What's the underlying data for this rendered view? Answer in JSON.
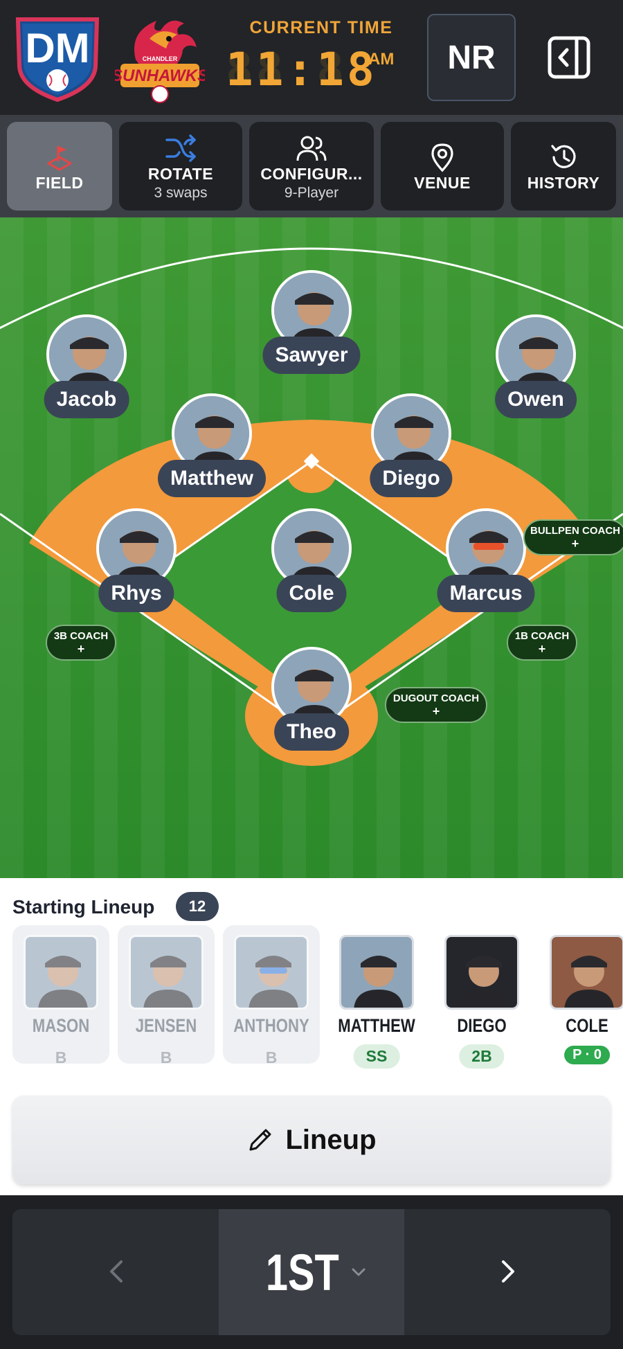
{
  "header": {
    "logo_dm_text": "DM",
    "logo_team_text": "SUNHAWKS",
    "logo_team_small": "CHANDLER",
    "time_label": "CURRENT TIME",
    "time_digits": "11:18",
    "time_ampm": "AM",
    "nr_label": "NR",
    "panel_icon": "sidebar-collapse-icon",
    "accent": "#f2a635"
  },
  "tabs": [
    {
      "label": "FIELD",
      "sub": "",
      "icon": "field-flag-icon",
      "active": true
    },
    {
      "label": "ROTATE",
      "sub": "3 swaps",
      "icon": "shuffle-icon",
      "active": false
    },
    {
      "label": "CONFIGUR...",
      "sub": "9-Player",
      "icon": "users-icon",
      "active": false
    },
    {
      "label": "VENUE",
      "sub": "",
      "icon": "map-pin-icon",
      "active": false
    },
    {
      "label": "HISTORY",
      "sub": "",
      "icon": "history-icon",
      "active": false
    }
  ],
  "field": {
    "players": {
      "cf": "Sawyer",
      "lf": "Jacob",
      "rf": "Owen",
      "ss": "Matthew",
      "second": "Diego",
      "third": "Rhys",
      "pitcher": "Cole",
      "first": "Marcus",
      "catcher": "Theo"
    },
    "coaches": {
      "bullpen": "BULLPEN COACH",
      "third_base": "3B COACH",
      "first_base": "1B COACH",
      "dugout": "DUGOUT COACH",
      "plus": "+"
    },
    "grass_color": "#3a9a36",
    "dirt_color": "#f39a3c"
  },
  "lineup": {
    "title": "Starting Lineup",
    "count": "12",
    "cards": [
      {
        "name": "MASON",
        "pos": "B",
        "state": "bench"
      },
      {
        "name": "JENSEN",
        "pos": "B",
        "state": "bench"
      },
      {
        "name": "ANTHONY",
        "pos": "B",
        "state": "bench"
      },
      {
        "name": "MATTHEW",
        "pos": "SS",
        "state": "active"
      },
      {
        "name": "DIEGO",
        "pos": "2B",
        "state": "active"
      },
      {
        "name": "COLE",
        "pos": "P · 0",
        "state": "pitching"
      }
    ],
    "button_label": "Lineup"
  },
  "bottom": {
    "inning": "1ST"
  }
}
